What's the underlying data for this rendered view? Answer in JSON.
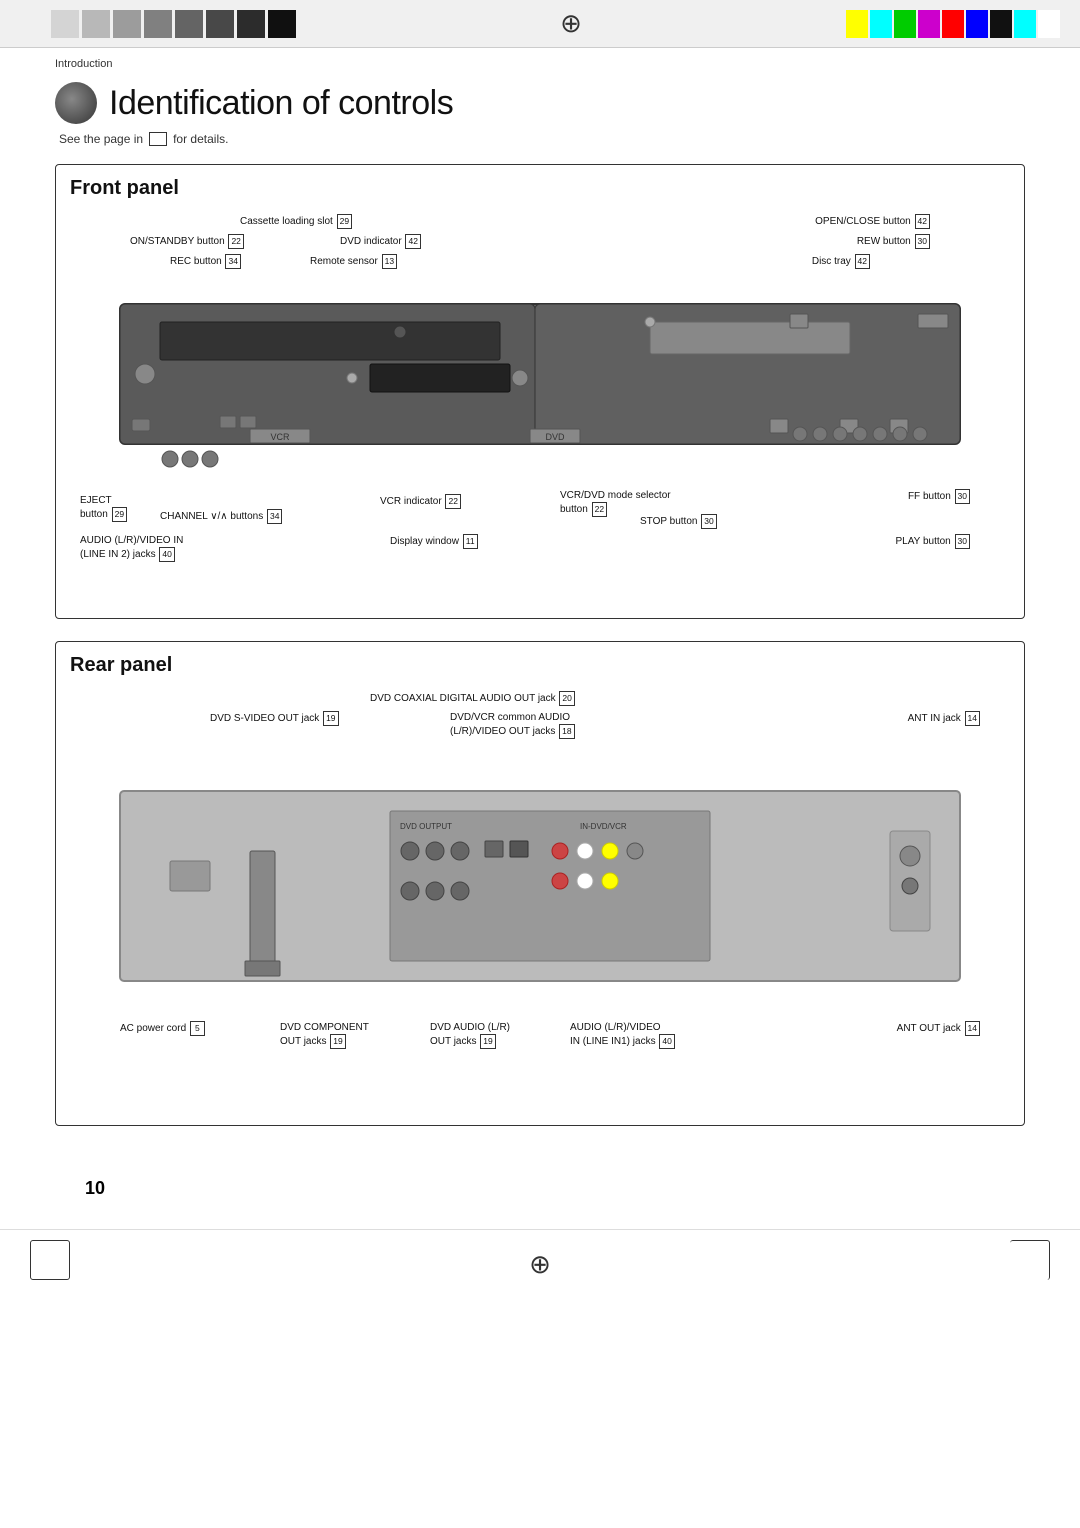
{
  "header": {
    "gray_bars": [
      "#f0f0f0",
      "#d4d4d4",
      "#b8b8b8",
      "#9c9c9c",
      "#808080",
      "#646464",
      "#484848",
      "#2c2c2c",
      "#101010"
    ],
    "color_bars": [
      "#ffff00",
      "#00ffff",
      "#00ff00",
      "#ff00ff",
      "#ff0000",
      "#0000ff",
      "#101010",
      "#00ffff",
      "#ffffff"
    ]
  },
  "breadcrumb": "Introduction",
  "page_title": "Identification of controls",
  "subtitle": "See the page in",
  "subtitle_suffix": "for details.",
  "front_panel": {
    "title": "Front panel",
    "labels": [
      {
        "text": "Cassette loading slot",
        "num": "29"
      },
      {
        "text": "ON/STANDBY button",
        "num": "22"
      },
      {
        "text": "REC button",
        "num": "34"
      },
      {
        "text": "Remote sensor",
        "num": "13"
      },
      {
        "text": "DVD indicator",
        "num": "42"
      },
      {
        "text": "OPEN/CLOSE button",
        "num": "42"
      },
      {
        "text": "REW button",
        "num": "30"
      },
      {
        "text": "Disc tray",
        "num": "42"
      },
      {
        "text": "EJECT button",
        "num": "29"
      },
      {
        "text": "CHANNEL ∨/∧ buttons",
        "num": "34"
      },
      {
        "text": "VCR indicator",
        "num": "22"
      },
      {
        "text": "VCR/DVD mode selector button",
        "num": "22"
      },
      {
        "text": "FF button",
        "num": "30"
      },
      {
        "text": "STOP button",
        "num": "30"
      },
      {
        "text": "AUDIO (L/R)/VIDEO IN (LINE IN 2) jacks",
        "num": "40"
      },
      {
        "text": "Display window",
        "num": "11"
      },
      {
        "text": "PLAY button",
        "num": "30"
      }
    ]
  },
  "rear_panel": {
    "title": "Rear panel",
    "labels": [
      {
        "text": "DVD COAXIAL DIGITAL AUDIO OUT jack",
        "num": "20"
      },
      {
        "text": "DVD S-VIDEO OUT jack",
        "num": "19"
      },
      {
        "text": "DVD/VCR common AUDIO (L/R)/VIDEO OUT jacks",
        "num": "18"
      },
      {
        "text": "ANT IN jack",
        "num": "14"
      },
      {
        "text": "AC power cord",
        "num": "5"
      },
      {
        "text": "DVD COMPONENT OUT jacks",
        "num": "19"
      },
      {
        "text": "DVD AUDIO (L/R) OUT jacks",
        "num": "19"
      },
      {
        "text": "AUDIO (L/R)/VIDEO IN (LINE IN1) jacks",
        "num": "40"
      },
      {
        "text": "ANT OUT jack",
        "num": "14"
      }
    ]
  },
  "page_number": "10"
}
